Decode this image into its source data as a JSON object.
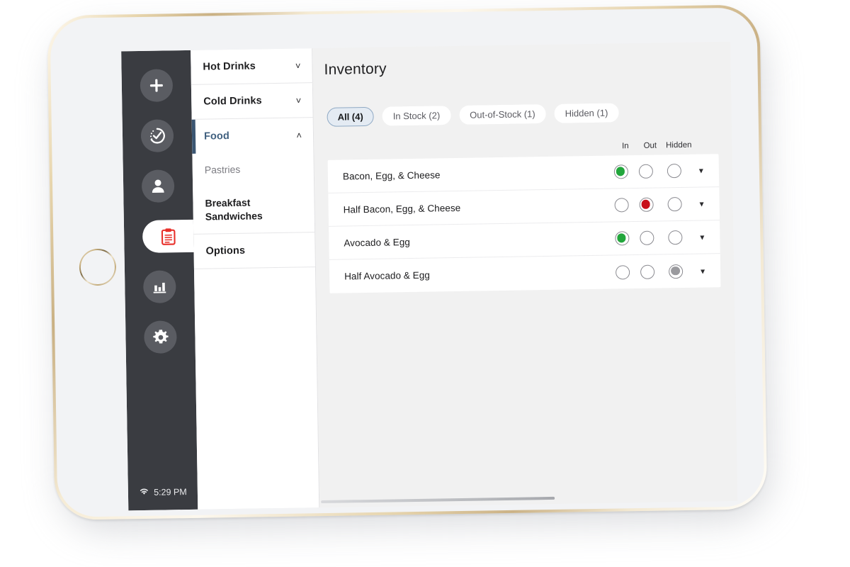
{
  "device": {
    "kind": "tablet",
    "bezel_color": "#d8c391",
    "home_button_name": "home-button",
    "camera_name": "front-camera"
  },
  "status_bar": {
    "wifi_icon": "wifi-icon",
    "time": "5:29 PM"
  },
  "rail": {
    "items": [
      {
        "icon": "plus-icon",
        "name": "add-button",
        "active": false
      },
      {
        "icon": "clock-check-icon",
        "name": "orders-button",
        "active": false
      },
      {
        "icon": "person-icon",
        "name": "customers-button",
        "active": false
      },
      {
        "icon": "clipboard-icon",
        "name": "inventory-button",
        "active": true
      },
      {
        "icon": "bar-chart-icon",
        "name": "reports-button",
        "active": false
      },
      {
        "icon": "gear-icon",
        "name": "settings-button",
        "active": false
      }
    ]
  },
  "header": {
    "title": "Inventory"
  },
  "categories": [
    {
      "label": "Hot Drinks",
      "chevron": "˅",
      "expanded": false,
      "children": []
    },
    {
      "label": "Cold Drinks",
      "chevron": "˅",
      "expanded": false,
      "children": []
    },
    {
      "label": "Food",
      "chevron": "˄",
      "expanded": true,
      "children": [
        {
          "label": "Pastries",
          "selected": false
        },
        {
          "label": "Breakfast Sandwiches",
          "selected": true
        }
      ]
    },
    {
      "label": "Options",
      "chevron": "",
      "expanded": false,
      "children": []
    }
  ],
  "filters": [
    {
      "label": "All (4)",
      "active": true
    },
    {
      "label": "In Stock (2)",
      "active": false
    },
    {
      "label": "Out-of-Stock (1)",
      "active": false
    },
    {
      "label": "Hidden (1)",
      "active": false
    }
  ],
  "table": {
    "columns": [
      "In",
      "Out",
      "Hidden"
    ],
    "expand_icon": "chevron-down-icon",
    "rows": [
      {
        "name": "Bacon, Egg, & Cheese",
        "state": "in"
      },
      {
        "name": "Half Bacon, Egg, & Cheese",
        "state": "out"
      },
      {
        "name": "Avocado & Egg",
        "state": "in"
      },
      {
        "name": "Half Avocado & Egg",
        "state": "hidden"
      }
    ]
  },
  "colors": {
    "rail_bg": "#3a3c41",
    "in_stock": "#22a63c",
    "out_of_stock": "#c8101a",
    "hidden": "#9a9a9e",
    "accent": "#3b5672",
    "chip_active_bg": "#e4ebf3",
    "clipboard_red": "#e8302a"
  }
}
